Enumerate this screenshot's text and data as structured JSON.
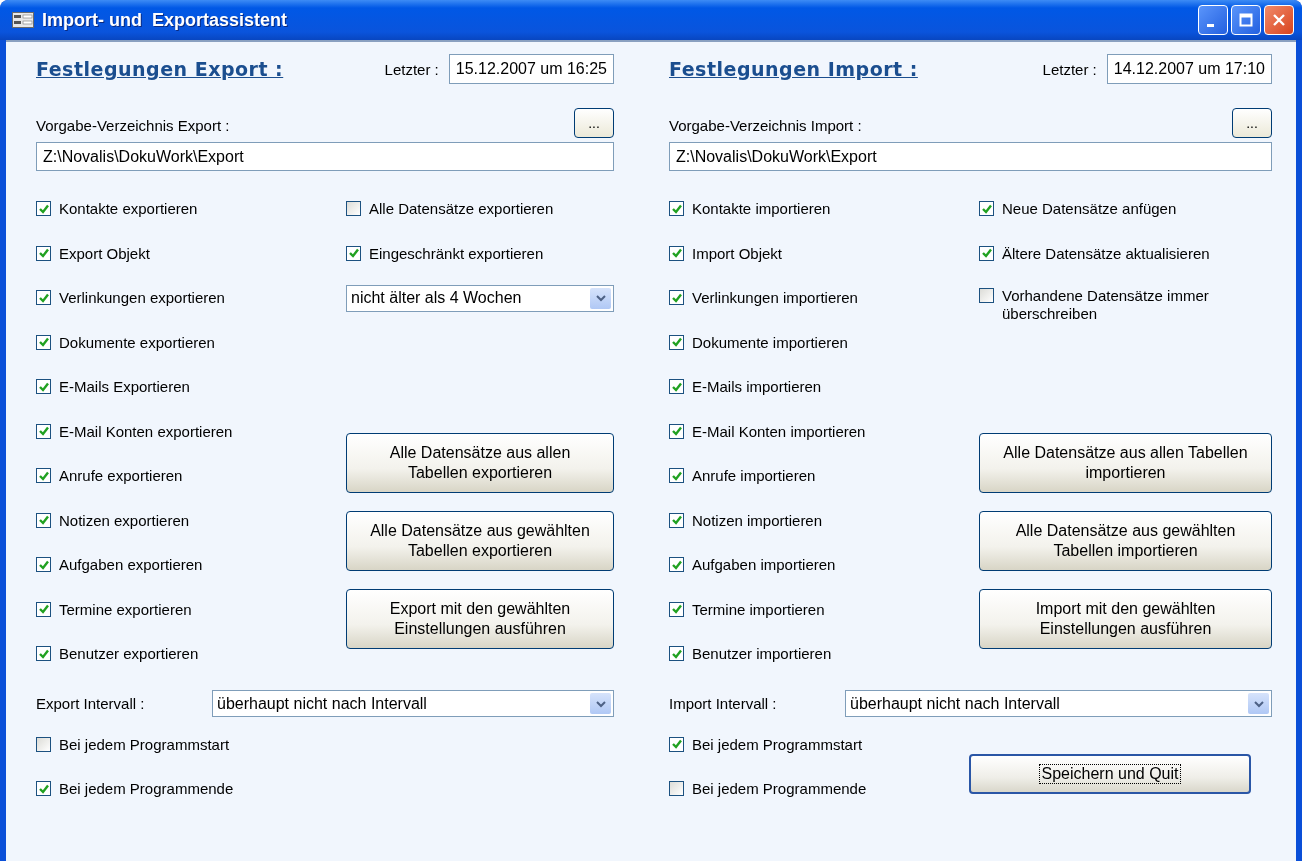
{
  "window": {
    "title": "Import- und  Exportassistent"
  },
  "panels": [
    {
      "heading": "Festlegungen Export :",
      "last_label": "Letzter :",
      "last_value": "15.12.2007 um 16:25",
      "dir_label": "Vorgabe-Verzeichnis Export :",
      "browse_button": "...",
      "dir_value": "Z:\\Novalis\\DokuWork\\Export",
      "items": [
        {
          "label": "Kontakte exportieren",
          "checked": true
        },
        {
          "label": "Export Objekt",
          "checked": true
        },
        {
          "label": "Verlinkungen exportieren",
          "checked": true
        },
        {
          "label": "Dokumente exportieren",
          "checked": true
        },
        {
          "label": "E-Mails Exportieren",
          "checked": true
        },
        {
          "label": "E-Mail Konten exportieren",
          "checked": true
        },
        {
          "label": "Anrufe exportieren",
          "checked": true
        },
        {
          "label": "Notizen exportieren",
          "checked": true
        },
        {
          "label": "Aufgaben exportieren",
          "checked": true
        },
        {
          "label": "Termine exportieren",
          "checked": true
        },
        {
          "label": "Benutzer exportieren",
          "checked": true
        }
      ],
      "options": [
        {
          "kind": "checkbox",
          "label": "Alle Datensätze exportieren",
          "checked": false
        },
        {
          "kind": "checkbox",
          "label": "Eingeschränkt exportieren",
          "checked": true
        },
        {
          "kind": "dropdown",
          "value": "nicht älter als 4 Wochen"
        }
      ],
      "buttons": [
        "Alle Datensätze aus allen Tabellen exportieren",
        "Alle Datensätze aus gewählten Tabellen exportieren",
        "Export mit den gewählten Einstellungen ausführen"
      ],
      "interval_label": "Export Intervall :",
      "interval_value": "überhaupt nicht nach Intervall",
      "triggers": [
        {
          "label": "Bei jedem Programmstart",
          "checked": false
        },
        {
          "label": "Bei jedem Programmende",
          "checked": true
        }
      ]
    },
    {
      "heading": "Festlegungen Import :",
      "last_label": "Letzter :",
      "last_value": "14.12.2007 um 17:10",
      "dir_label": "Vorgabe-Verzeichnis Import :",
      "browse_button": "...",
      "dir_value": "Z:\\Novalis\\DokuWork\\Export",
      "items": [
        {
          "label": "Kontakte importieren",
          "checked": true
        },
        {
          "label": "Import Objekt",
          "checked": true
        },
        {
          "label": "Verlinkungen importieren",
          "checked": true
        },
        {
          "label": "Dokumente importieren",
          "checked": true
        },
        {
          "label": "E-Mails importieren",
          "checked": true
        },
        {
          "label": "E-Mail Konten importieren",
          "checked": true
        },
        {
          "label": "Anrufe importieren",
          "checked": true
        },
        {
          "label": "Notizen importieren",
          "checked": true
        },
        {
          "label": "Aufgaben importieren",
          "checked": true
        },
        {
          "label": "Termine importieren",
          "checked": true
        },
        {
          "label": "Benutzer importieren",
          "checked": true
        }
      ],
      "options": [
        {
          "kind": "checkbox",
          "label": "Neue Datensätze anfügen",
          "checked": true
        },
        {
          "kind": "checkbox",
          "label": "Ältere Datensätze aktualisieren",
          "checked": true
        },
        {
          "kind": "checkbox",
          "label": "Vorhandene Datensätze immer überschreiben",
          "checked": false
        }
      ],
      "buttons": [
        "Alle Datensätze aus allen Tabellen importieren",
        "Alle Datensätze aus gewählten Tabellen importieren",
        "Import mit den gewählten Einstellungen ausführen"
      ],
      "interval_label": "Import Intervall :",
      "interval_value": "überhaupt nicht nach Intervall",
      "triggers": [
        {
          "label": "Bei jedem Programmstart",
          "checked": true
        },
        {
          "label": "Bei jedem Programmende",
          "checked": false
        }
      ],
      "save_button": "Speichern und Quit"
    }
  ]
}
